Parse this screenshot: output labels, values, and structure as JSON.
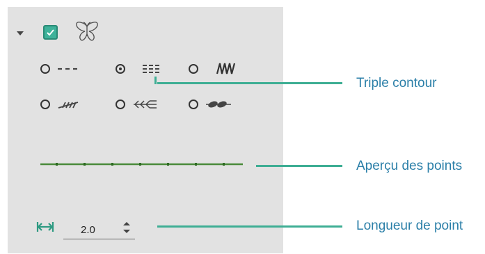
{
  "panel": {
    "expand_icon": "triangle-down-icon",
    "enabled_checked": true,
    "motif_icon": "butterfly-icon",
    "stitch_types": [
      {
        "icon": "dashed-line-icon",
        "selected": false
      },
      {
        "icon": "triple-line-icon",
        "selected": true
      },
      {
        "icon": "zigzag-icon",
        "selected": false
      },
      {
        "icon": "slanted-stitch-icon",
        "selected": false
      },
      {
        "icon": "arrow-stitch-icon",
        "selected": false
      },
      {
        "icon": "bead-stitch-icon",
        "selected": false
      }
    ],
    "preview_color": "#4a8a3a",
    "stitch_length": "2.0"
  },
  "callouts": {
    "triple_contour": "Triple contour",
    "stitch_preview": "Aperçu des points",
    "stitch_length": "Longueur de point"
  },
  "colors": {
    "accent": "#3eae94",
    "callout_text": "#2b7fa8",
    "panel_bg": "#e2e2e2"
  }
}
